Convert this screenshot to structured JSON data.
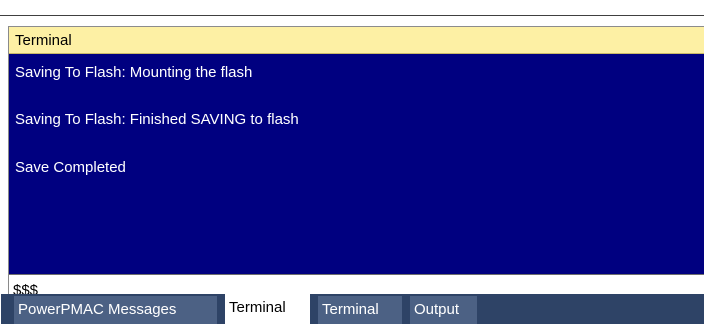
{
  "panel": {
    "title": "Terminal"
  },
  "output": {
    "lines": [
      "Saving To Flash: Mounting the flash",
      "Saving To Flash: Finished SAVING to flash",
      "Save Completed"
    ]
  },
  "command": {
    "value": "$$$"
  },
  "tabs": [
    {
      "label": "PowerPMAC Messages",
      "active": false
    },
    {
      "label": "Terminal",
      "active": true
    },
    {
      "label": "Terminal",
      "active": false
    },
    {
      "label": "Output",
      "active": false
    }
  ],
  "colors": {
    "title_bar": "#fdf0a4",
    "output_background": "#000080",
    "output_text": "#ffffff",
    "tab_strip": "#2e4366",
    "tab_inactive": "#4c6184",
    "tab_active": "#ffffff"
  }
}
